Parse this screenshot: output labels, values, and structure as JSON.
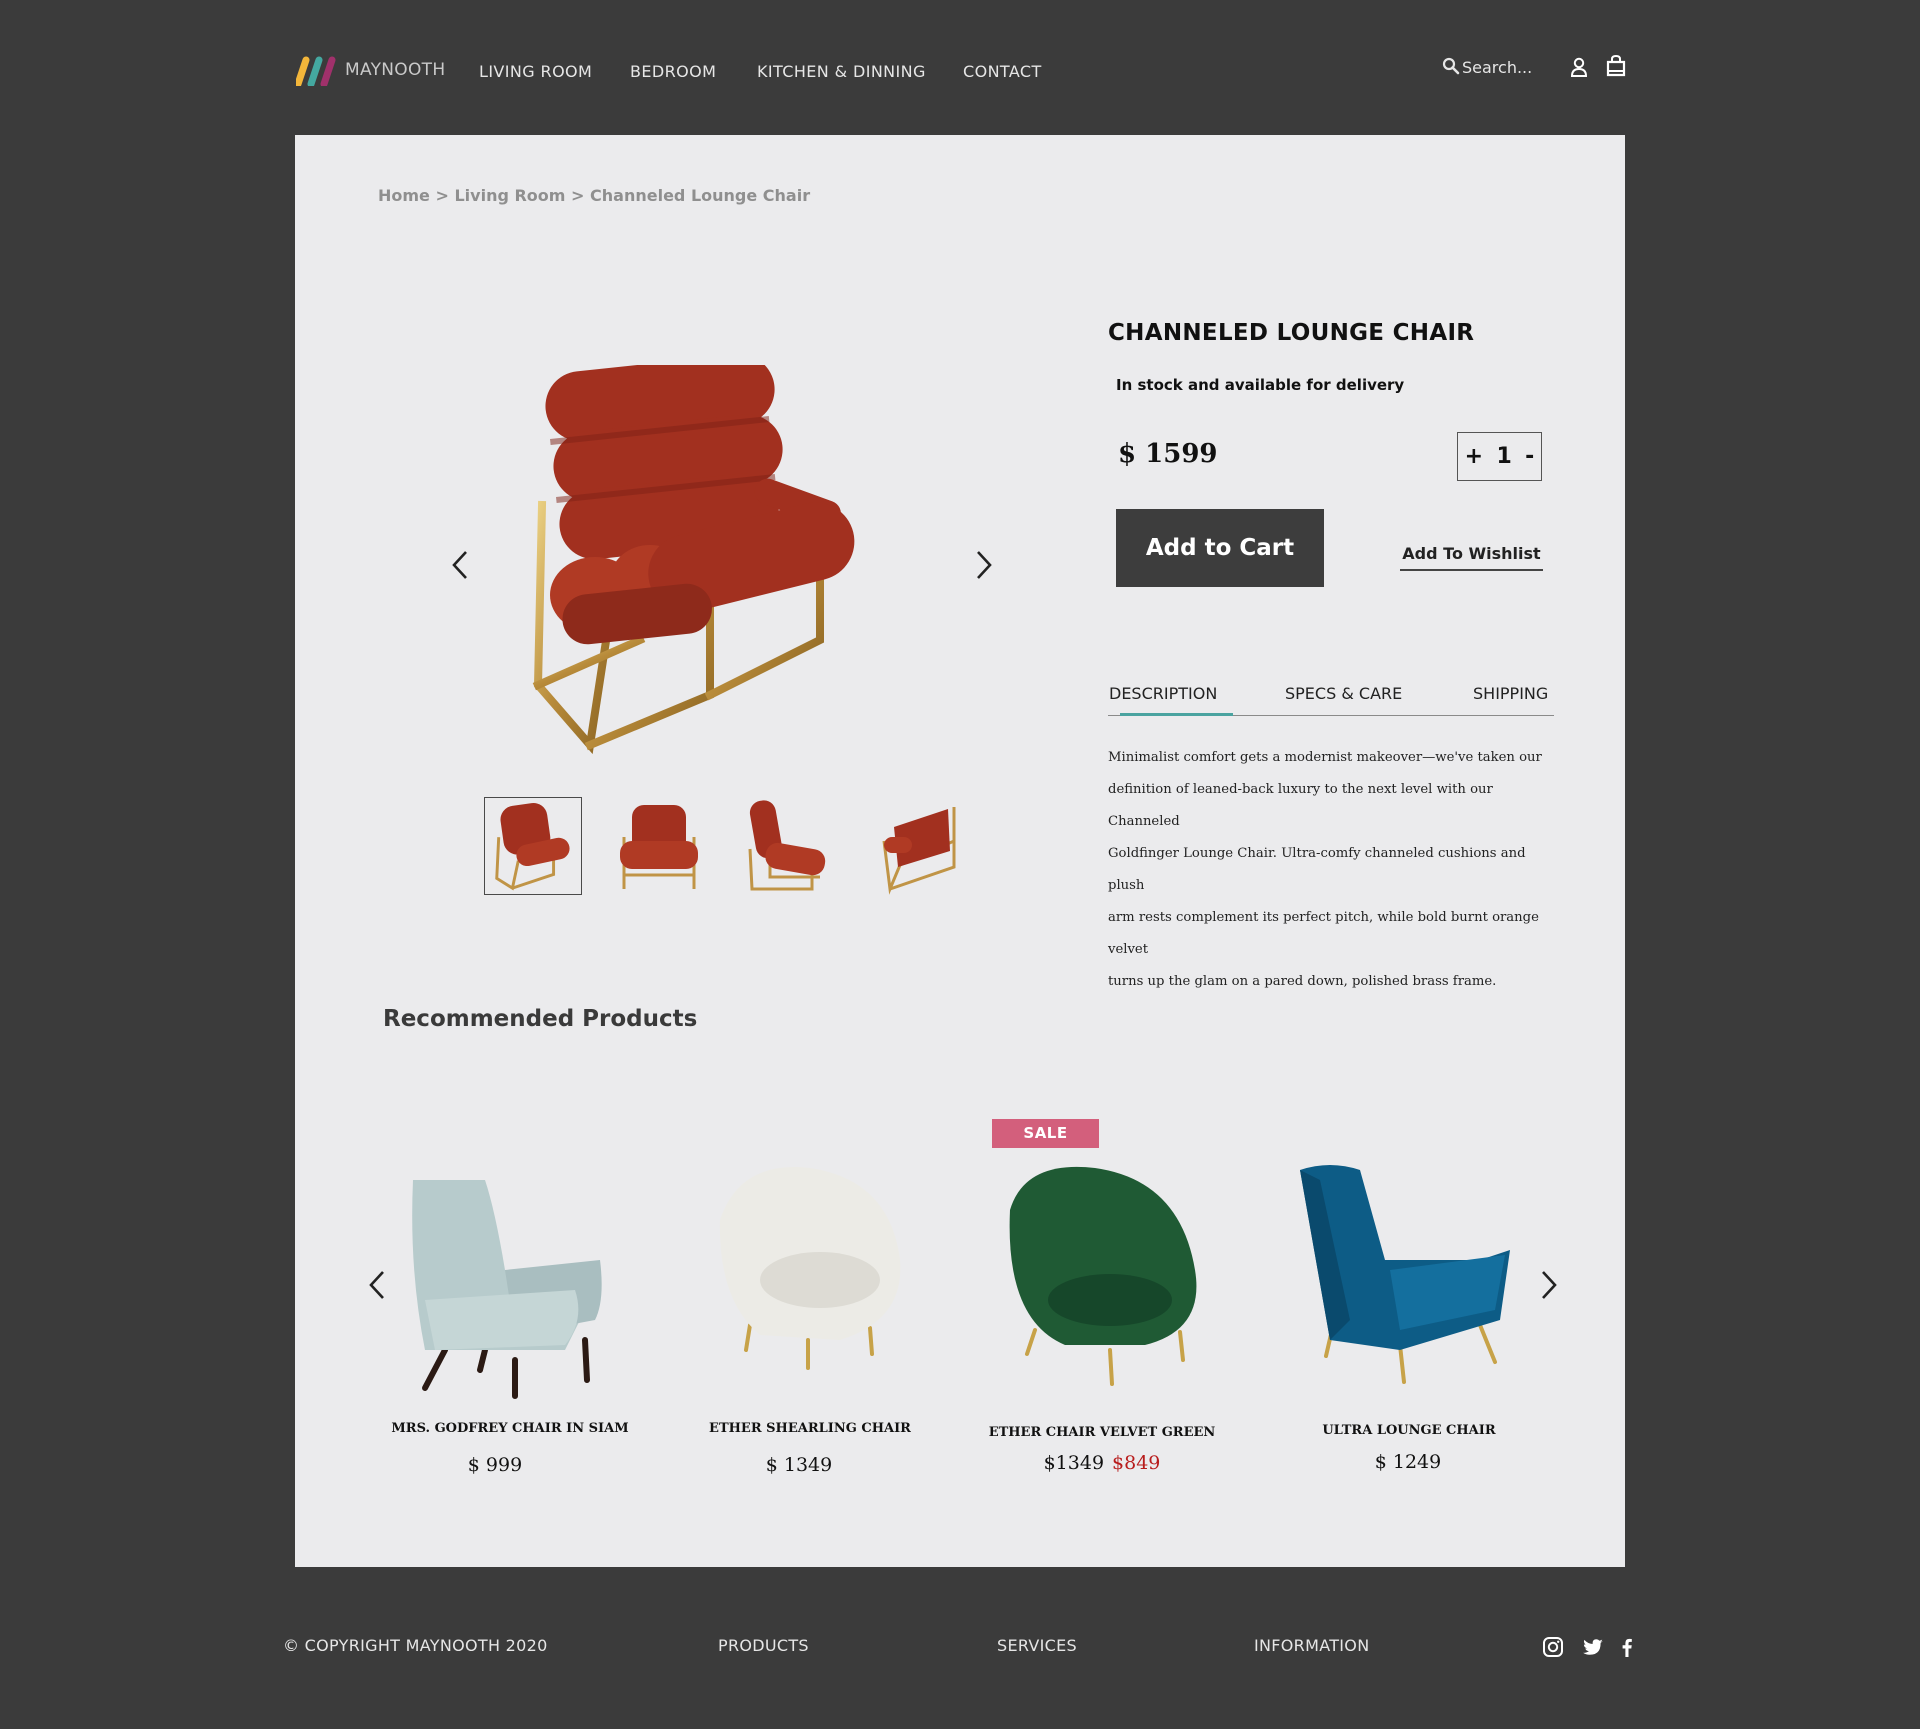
{
  "header": {
    "brand": "MAYNOOTH",
    "nav": [
      "LIVING ROOM",
      "BEDROOM",
      "KITCHEN & DINNING",
      "CONTACT"
    ],
    "search_placeholder": "Search...",
    "icons": [
      "search-icon",
      "user-icon",
      "cart-icon"
    ]
  },
  "breadcrumb": {
    "items": [
      "Home",
      "Living Room",
      "Channeled Lounge Chair"
    ],
    "separator": ">"
  },
  "product": {
    "title": "CHANNELED LOUNGE CHAIR",
    "stock": "In stock and available for delivery",
    "price": "$ 1599",
    "quantity": "1",
    "qty_plus": "+",
    "qty_minus": "-",
    "add_to_cart": "Add to Cart",
    "add_to_wishlist": "Add To Wishlist",
    "color": "#a2301f",
    "thumbnails_count": 4,
    "selected_thumbnail": 1
  },
  "tabs": {
    "items": [
      "DESCRIPTION",
      "SPECS & CARE",
      "SHIPPING"
    ],
    "active": "DESCRIPTION",
    "accent_color": "#4aa3a0"
  },
  "description": {
    "lines": [
      "Minimalist comfort gets a modernist makeover—we've taken our",
      "definition of leaned-back luxury to the next level with our Channeled",
      "Goldfinger Lounge Chair. Ultra-comfy channeled cushions and plush",
      "arm rests complement its perfect pitch, while bold burnt orange velvet",
      "turns up the glam on a pared down, polished brass frame."
    ]
  },
  "recommended": {
    "title": "Recommended Products",
    "items": [
      {
        "name": "MRS. GODFREY CHAIR IN SIAM",
        "price": "$ 999",
        "color": "#b7cbcc"
      },
      {
        "name": "ETHER SHEARLING CHAIR",
        "price": "$ 1349",
        "color": "#ecebe6"
      },
      {
        "name": "ETHER CHAIR VELVET GREEN",
        "price": "$1349",
        "sale_price": "$849",
        "badge": "SALE",
        "color": "#1f5a34"
      },
      {
        "name": "ULTRA LOUNGE CHAIR",
        "price": "$ 1249",
        "color": "#0d5c86"
      }
    ]
  },
  "footer": {
    "copyright": "© COPYRIGHT MAYNOOTH 2020",
    "links": [
      "PRODUCTS",
      "SERVICES",
      "INFORMATION"
    ],
    "social": [
      "instagram-icon",
      "twitter-icon",
      "facebook-icon"
    ]
  },
  "colors": {
    "page_bg": "#3b3b3b",
    "card_bg": "#ebebed",
    "button_bg": "#3d3d3d",
    "sale_badge": "#d35f7c",
    "sale_price": "#b81c1c"
  }
}
